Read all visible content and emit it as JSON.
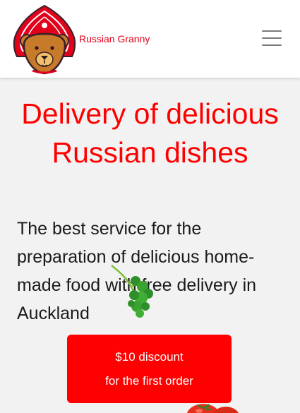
{
  "header": {
    "brand_name": "Russian Granny",
    "logo_icon": "bear-kokoshnik-logo",
    "menu_icon": "hamburger-menu-icon"
  },
  "hero": {
    "title": "Delivery of delicious Russian dishes",
    "description": "The best service for the preparation of delicious home-made food with free delivery in Auckland",
    "cta_line1": "$10 discount",
    "cta_line2": "for the first order"
  },
  "colors": {
    "accent": "#ff0000",
    "brand_text": "#e3001b",
    "background": "#f2f2f2",
    "header_bg": "#ffffff",
    "body_text": "#1a1a1a"
  }
}
